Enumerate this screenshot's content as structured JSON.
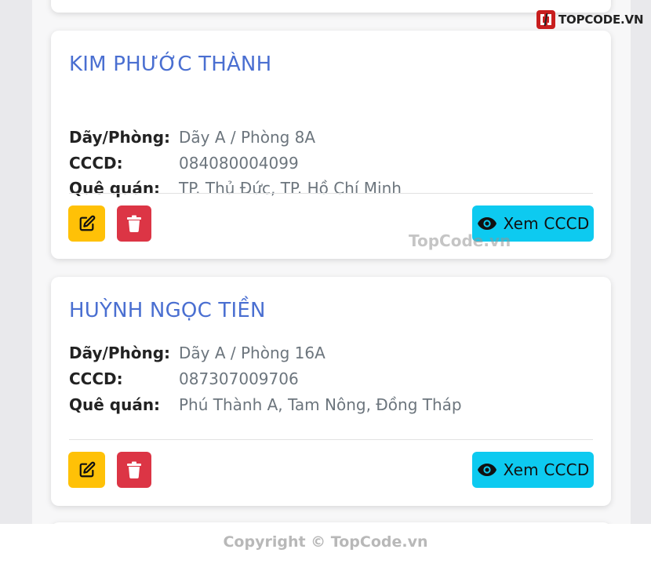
{
  "brand": {
    "logo_text": "TOPCODE.VN"
  },
  "watermark": {
    "text": "TopCode.vn"
  },
  "footer": {
    "copyright": "Copyright © TopCode.vn"
  },
  "labels": {
    "room": "Dãy/Phòng:",
    "id_card": "CCCD:",
    "hometown": "Quê quán:"
  },
  "tenants": [
    {
      "name": "KIM PHƯỚC THÀNH",
      "room": "Dãy A / Phòng 8A",
      "id_card": "084080004099",
      "hometown": "TP. Thủ Đức, TP. Hồ Chí Minh",
      "view_label": "Xem CCCD"
    },
    {
      "name": "HUỲNH NGỌC TIỀN",
      "room": "Dãy A / Phòng 16A",
      "id_card": "087307009706",
      "hometown": "Phú Thành A, Tam Nông, Đồng Tháp",
      "view_label": "Xem CCCD"
    }
  ],
  "colors": {
    "name": "#4a6fd1",
    "edit_button": "#ffc107",
    "delete_button": "#dc3545",
    "view_button": "#0dcaf0"
  },
  "icons": {
    "edit": "pencil-square-icon",
    "delete": "trash-icon",
    "view": "eye-icon"
  }
}
